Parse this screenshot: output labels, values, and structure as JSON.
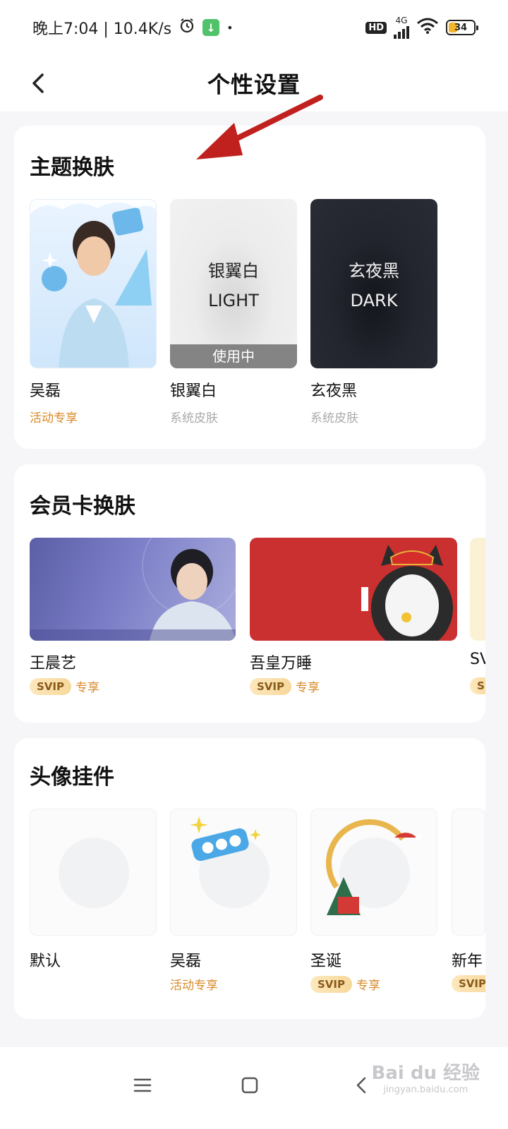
{
  "status_bar": {
    "time_speed": "晚上7:04 | 10.4K/s",
    "hd": "HD",
    "network": "4G",
    "battery": "34",
    "battery_level": 0.34
  },
  "header": {
    "title": "个性设置"
  },
  "theme_section": {
    "title": "主题换肤",
    "items": [
      {
        "name": "吴磊",
        "subtitle": "活动专享"
      },
      {
        "name": "银翼白",
        "subtitle": "系统皮肤",
        "tile_text": "银翼白",
        "tile_text_en": "LIGHT",
        "status": "使用中"
      },
      {
        "name": "玄夜黑",
        "subtitle": "系统皮肤",
        "tile_text": "玄夜黑",
        "tile_text_en": "DARK"
      }
    ]
  },
  "member_card_section": {
    "title": "会员卡换肤",
    "items": [
      {
        "name": "王晨艺",
        "badge": "SVIP",
        "suffix": "专享"
      },
      {
        "name": "吾皇万睡",
        "badge": "SVIP",
        "suffix": "专享"
      },
      {
        "name": "SV",
        "badge": "S"
      }
    ]
  },
  "avatar_section": {
    "title": "头像挂件",
    "items": [
      {
        "name": "默认"
      },
      {
        "name": "吴磊",
        "subtitle": "活动专享"
      },
      {
        "name": "圣诞",
        "badge": "SVIP",
        "suffix": "专享"
      },
      {
        "name": "新年",
        "badge": "SVIP"
      }
    ]
  },
  "watermark": {
    "brand": "Bai du 经验",
    "url": "jingyan.baidu.com"
  },
  "colors": {
    "accent_orange": "#d98a2b",
    "annotation_arrow": "#c0211e",
    "svip_badge": "#f6d89b"
  }
}
